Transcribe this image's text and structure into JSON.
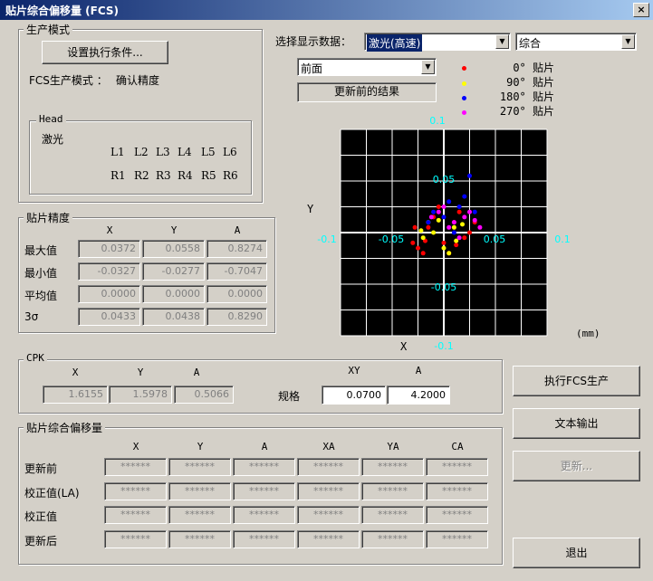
{
  "window": {
    "title": "贴片综合偏移量 (FCS)",
    "close_label": "×"
  },
  "production_mode": {
    "group_label": "生产模式",
    "set_conditions_button": "设置执行条件...",
    "mode_label": "FCS生产模式 ：",
    "mode_value": "确认精度",
    "head": {
      "group_label": "Head",
      "type": "激光",
      "row1": [
        "L1",
        "L2",
        "L3",
        "L4",
        "L5",
        "L6"
      ],
      "row2": [
        "R1",
        "R2",
        "R3",
        "R4",
        "R5",
        "R6"
      ]
    }
  },
  "display": {
    "select_label": "选择显示数据：",
    "data_source": "激光(高速)",
    "mode": "综合",
    "view": "前面",
    "result_button": "更新前的结果",
    "legend": [
      {
        "label": "0° 贴片",
        "color": "#ff0000"
      },
      {
        "label": "90° 贴片",
        "color": "#ffff00"
      },
      {
        "label": "180° 贴片",
        "color": "#0000ff"
      },
      {
        "label": "270° 贴片",
        "color": "#ff00ff"
      }
    ]
  },
  "plot": {
    "axis_y": "Y",
    "axis_x": "X",
    "unit": "(mm)",
    "tick_top": "0.1",
    "tick_bottom": "-0.1",
    "tick_left": "-0.1",
    "tick_right": "0.1",
    "tick_y_pos": "0.05",
    "tick_y_neg": "-0.05",
    "tick_x_neg": "-0.05",
    "tick_x_pos": "0.05",
    "background": "#000000",
    "grid_color": "#ffffff",
    "label_color": "#00ffff"
  },
  "chart_data": {
    "type": "scatter",
    "xlim": [
      -0.1,
      0.1
    ],
    "ylim": [
      -0.1,
      0.1
    ],
    "xlabel": "X",
    "ylabel": "Y",
    "grid": true,
    "series": [
      {
        "name": "0° 贴片",
        "color": "#ff0000",
        "x": [
          -0.03,
          -0.02,
          -0.025,
          -0.015,
          0.0,
          0.01,
          0.02,
          0.015,
          -0.01,
          0.005,
          0.025,
          -0.005,
          0.03,
          -0.028,
          0.012,
          -0.018
        ],
        "y": [
          -0.01,
          -0.02,
          -0.015,
          0.005,
          -0.01,
          0.01,
          -0.005,
          0.02,
          0.015,
          -0.02,
          0.0,
          0.025,
          0.01,
          0.005,
          -0.012,
          -0.008
        ]
      },
      {
        "name": "90° 贴片",
        "color": "#ffff00",
        "x": [
          -0.02,
          -0.01,
          0.0,
          0.01,
          -0.015,
          0.005,
          0.018,
          -0.005,
          0.012,
          -0.022
        ],
        "y": [
          -0.005,
          0.0,
          -0.015,
          0.005,
          0.01,
          -0.02,
          0.008,
          0.012,
          -0.008,
          0.002
        ]
      },
      {
        "name": "180° 贴片",
        "color": "#0000ff",
        "x": [
          0.025,
          0.005,
          0.015,
          -0.01,
          0.0,
          0.02,
          -0.015,
          0.01,
          0.03
        ],
        "y": [
          0.055,
          0.03,
          0.025,
          0.02,
          0.015,
          0.035,
          0.01,
          0.0,
          0.02
        ]
      },
      {
        "name": "270° 贴片",
        "color": "#ff00ff",
        "x": [
          0.035,
          0.02,
          0.01,
          -0.005,
          0.0,
          0.015,
          -0.012,
          0.025,
          0.005,
          0.03
        ],
        "y": [
          0.005,
          0.015,
          0.01,
          0.02,
          0.025,
          -0.005,
          0.015,
          0.02,
          0.005,
          0.012
        ]
      }
    ]
  },
  "accuracy": {
    "group_label": "贴片精度",
    "headers": [
      "X",
      "Y",
      "A"
    ],
    "rows": [
      {
        "label": "最大值",
        "values": [
          "0.0372",
          "0.0558",
          "0.8274"
        ]
      },
      {
        "label": "最小值",
        "values": [
          "-0.0327",
          "-0.0277",
          "-0.7047"
        ]
      },
      {
        "label": "平均值",
        "values": [
          "0.0000",
          "0.0000",
          "0.0000"
        ]
      },
      {
        "label": "3σ",
        "values": [
          "0.0433",
          "0.0438",
          "0.8290"
        ]
      }
    ]
  },
  "cpk": {
    "group_label": "CPK",
    "headers": [
      "X",
      "Y",
      "A"
    ],
    "values": [
      "1.6155",
      "1.5978",
      "0.5066"
    ],
    "spec_label": "规格",
    "spec_headers": [
      "XY",
      "A"
    ],
    "spec_values": [
      "0.0700",
      "4.2000"
    ]
  },
  "offset": {
    "group_label": "贴片综合偏移量",
    "headers": [
      "X",
      "Y",
      "A",
      "XA",
      "YA",
      "CA"
    ],
    "rows": [
      {
        "label": "更新前",
        "values": [
          "******",
          "******",
          "******",
          "******",
          "******",
          "******"
        ]
      },
      {
        "label": "校正值(LA)",
        "values": [
          "******",
          "******",
          "******",
          "******",
          "******",
          "******"
        ]
      },
      {
        "label": "校正值",
        "values": [
          "******",
          "******",
          "******",
          "******",
          "******",
          "******"
        ]
      },
      {
        "label": "更新后",
        "values": [
          "******",
          "******",
          "******",
          "******",
          "******",
          "******"
        ]
      }
    ]
  },
  "actions": {
    "run_button": "执行FCS生产",
    "export_button": "文本输出",
    "update_button": "更新...",
    "exit_button": "退出"
  }
}
